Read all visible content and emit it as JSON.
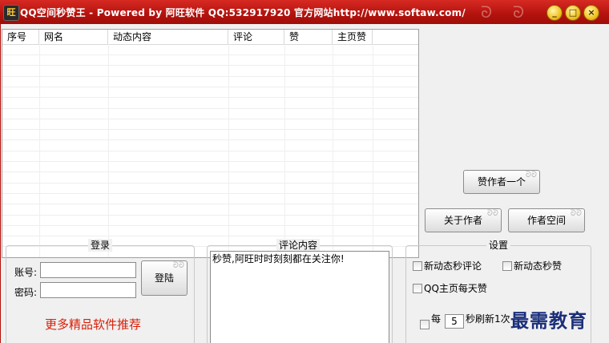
{
  "window": {
    "title": "QQ空间秒赞王 - Powered by 阿旺软件  QQ:532917920  官方网站http://www.softaw.com/",
    "icon_glyph": "旺",
    "controls": {
      "minimize": "_",
      "maximize": "□",
      "close": "×"
    }
  },
  "grid": {
    "columns": [
      "序号",
      "网名",
      "动态内容",
      "评论",
      "赞",
      "主页赞"
    ],
    "rows": []
  },
  "buttons": {
    "like_author": "赞作者一个",
    "about_author": "关于作者",
    "author_space": "作者空间"
  },
  "login": {
    "group_title": "登录",
    "account_label": "账号:",
    "password_label": "密码:",
    "account_value": "",
    "password_value": "",
    "login_button": "登陆",
    "promo_link": "更多精品软件推荐"
  },
  "comment": {
    "group_title": "评论内容",
    "text": "秒赞,阿旺时时刻刻都在关注你!"
  },
  "settings": {
    "group_title": "设置",
    "new_feed_comment": "新动态秒评论",
    "new_feed_like": "新动态秒赞",
    "homepage_daily_like": "QQ主页每天赞",
    "every_label": "每",
    "interval_value": "5",
    "refresh_label": "秒刷新1次"
  },
  "watermark": "最需教育",
  "colors": {
    "title_bar": "#b3120d",
    "promo_text": "#d81e06",
    "watermark": "#1a2e7a"
  }
}
